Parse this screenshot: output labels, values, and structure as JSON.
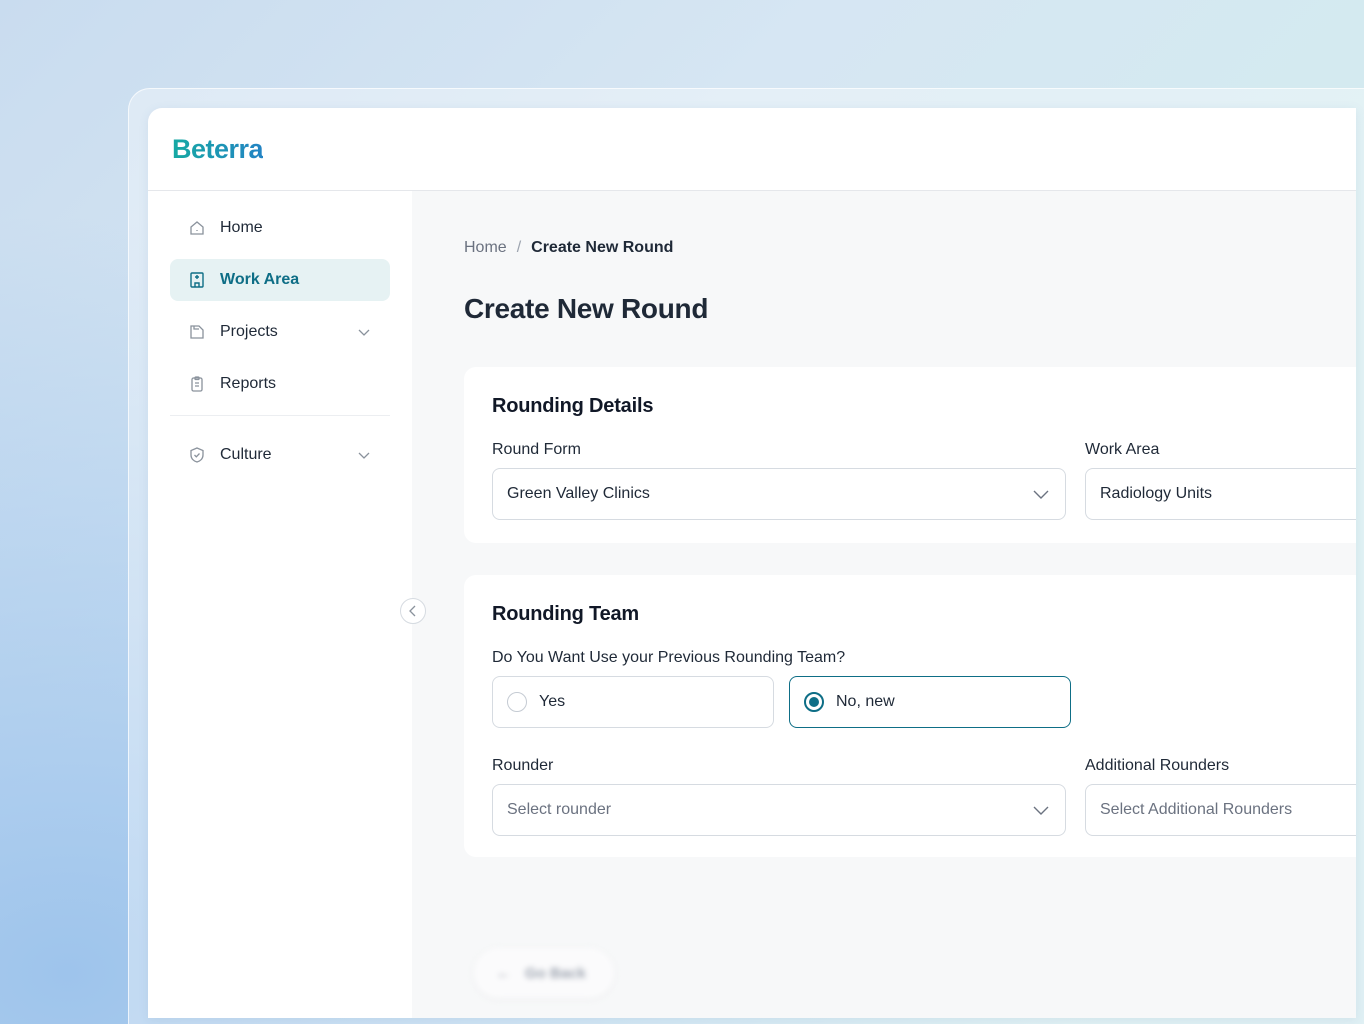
{
  "brand": {
    "logo": "Beterra"
  },
  "sidebar": {
    "items": [
      {
        "label": "Home",
        "icon": "home-icon"
      },
      {
        "label": "Work Area",
        "icon": "building-icon",
        "active": true
      },
      {
        "label": "Projects",
        "icon": "folder-icon",
        "expandable": true
      },
      {
        "label": "Reports",
        "icon": "clipboard-icon"
      },
      {
        "label": "Culture",
        "icon": "shield-icon",
        "expandable": true
      }
    ]
  },
  "breadcrumb": {
    "home": "Home",
    "separator": "/",
    "current": "Create New Round"
  },
  "page": {
    "title": "Create New Round"
  },
  "rounding_details": {
    "title": "Rounding Details",
    "round_form": {
      "label": "Round Form",
      "value": "Green Valley Clinics"
    },
    "work_area": {
      "label": "Work Area",
      "value": "Radiology Units"
    }
  },
  "rounding_team": {
    "title": "Rounding Team",
    "question": "Do You Want Use your Previous Rounding Team?",
    "options": [
      {
        "label": "Yes",
        "selected": false
      },
      {
        "label": "No, new",
        "selected": true
      }
    ],
    "rounder": {
      "label": "Rounder",
      "placeholder": "Select rounder"
    },
    "additional_rounders": {
      "label": "Additional Rounders",
      "placeholder": "Select Additional Rounders"
    }
  },
  "footer": {
    "back_label": "Go Back"
  },
  "colors": {
    "accent": "#0e6e86",
    "active_bg": "#e6f2f3",
    "logo_start": "#16a9a3",
    "logo_end": "#2383c4"
  }
}
